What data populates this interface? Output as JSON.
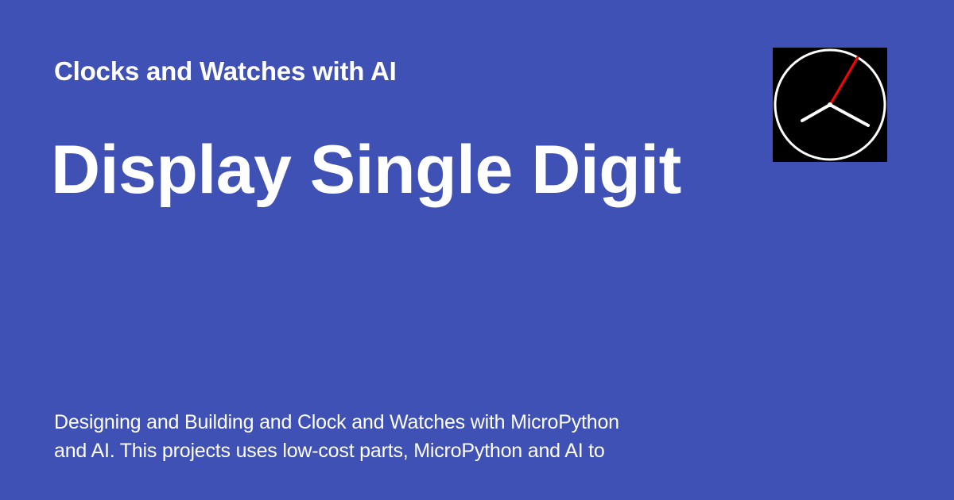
{
  "site": {
    "title": "Clocks and Watches with AI"
  },
  "page": {
    "title": "Display Single Digit",
    "description": "Designing and Building and Clock and Watches with MicroPython\nand AI.  This projects uses low-cost parts, MicroPython and AI to"
  },
  "logo": {
    "icon": "analog-clock-icon",
    "background_color": "#000000",
    "face_color": "#ffffff",
    "second_hand_color": "#ff0000"
  },
  "colors": {
    "background": "#3f51b5",
    "text": "#ffffff"
  }
}
